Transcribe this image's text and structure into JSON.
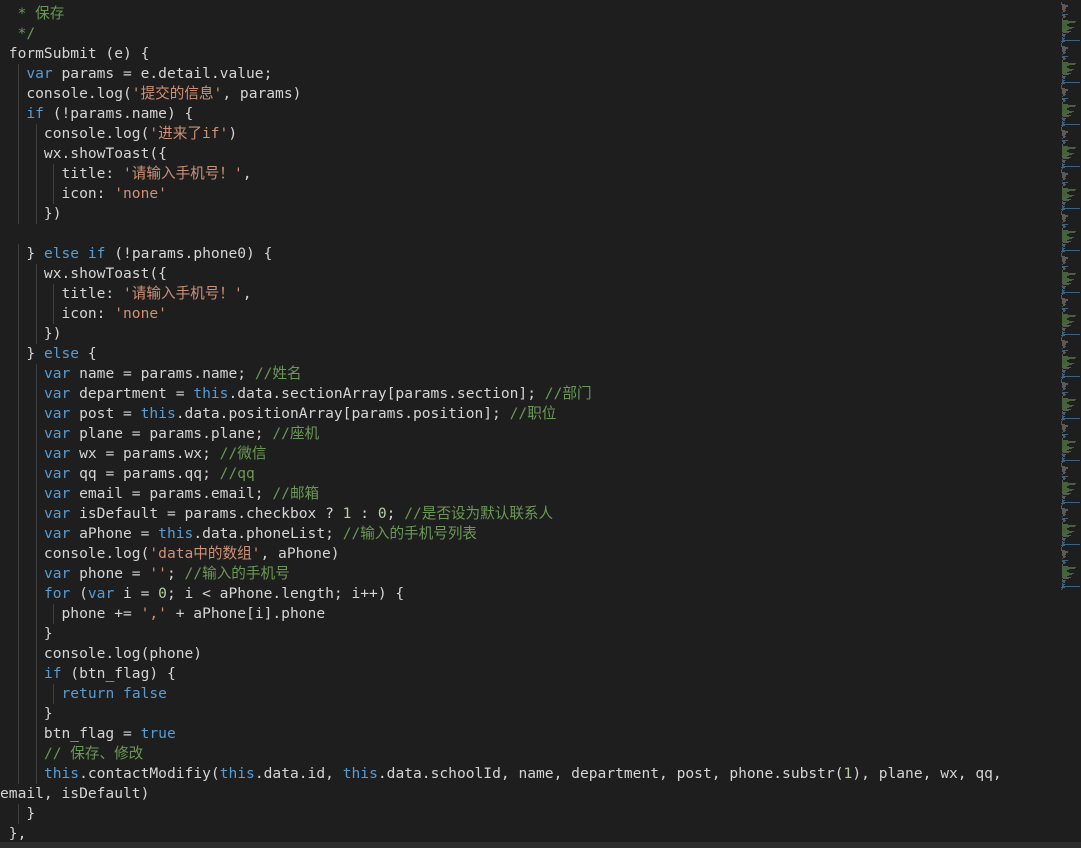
{
  "colors": {
    "background": "#1e1e1e",
    "keyword": "#569cd6",
    "string": "#ce9178",
    "comment": "#6a9955",
    "number": "#b5cea8",
    "text": "#d4d4d4"
  },
  "code_lines": [
    [
      {
        "t": "  * 保存",
        "c": "cm"
      }
    ],
    [
      {
        "t": "  */",
        "c": "cm"
      }
    ],
    [
      {
        "t": " formSubmit (e) {",
        "c": ""
      }
    ],
    [
      {
        "t": "   ",
        "c": ""
      },
      {
        "t": "var",
        "c": "kw"
      },
      {
        "t": " params = e.detail.value;",
        "c": ""
      }
    ],
    [
      {
        "t": "   console.log(",
        "c": ""
      },
      {
        "t": "'提交的信息'",
        "c": "str"
      },
      {
        "t": ", params)",
        "c": ""
      }
    ],
    [
      {
        "t": "   ",
        "c": ""
      },
      {
        "t": "if",
        "c": "kw"
      },
      {
        "t": " (!params.name) {",
        "c": ""
      }
    ],
    [
      {
        "t": "     console.log(",
        "c": ""
      },
      {
        "t": "'进来了if'",
        "c": "str"
      },
      {
        "t": ")",
        "c": ""
      }
    ],
    [
      {
        "t": "     wx.showToast({",
        "c": ""
      }
    ],
    [
      {
        "t": "       title: ",
        "c": ""
      },
      {
        "t": "'请输入手机号！'",
        "c": "str"
      },
      {
        "t": ",",
        "c": ""
      }
    ],
    [
      {
        "t": "       icon: ",
        "c": ""
      },
      {
        "t": "'none'",
        "c": "str"
      }
    ],
    [
      {
        "t": "     })",
        "c": ""
      }
    ],
    [
      {
        "t": "",
        "c": ""
      }
    ],
    [
      {
        "t": "   } ",
        "c": ""
      },
      {
        "t": "else",
        "c": "kw"
      },
      {
        "t": " ",
        "c": ""
      },
      {
        "t": "if",
        "c": "kw"
      },
      {
        "t": " (!params.phone0) {",
        "c": ""
      }
    ],
    [
      {
        "t": "     wx.showToast({",
        "c": ""
      }
    ],
    [
      {
        "t": "       title: ",
        "c": ""
      },
      {
        "t": "'请输入手机号！'",
        "c": "str"
      },
      {
        "t": ",",
        "c": ""
      }
    ],
    [
      {
        "t": "       icon: ",
        "c": ""
      },
      {
        "t": "'none'",
        "c": "str"
      }
    ],
    [
      {
        "t": "     })",
        "c": ""
      }
    ],
    [
      {
        "t": "   } ",
        "c": ""
      },
      {
        "t": "else",
        "c": "kw"
      },
      {
        "t": " {",
        "c": ""
      }
    ],
    [
      {
        "t": "     ",
        "c": ""
      },
      {
        "t": "var",
        "c": "kw"
      },
      {
        "t": " name = params.name; ",
        "c": ""
      },
      {
        "t": "//姓名",
        "c": "cm"
      }
    ],
    [
      {
        "t": "     ",
        "c": ""
      },
      {
        "t": "var",
        "c": "kw"
      },
      {
        "t": " department = ",
        "c": ""
      },
      {
        "t": "this",
        "c": "kw"
      },
      {
        "t": ".data.sectionArray[params.section]; ",
        "c": ""
      },
      {
        "t": "//部门",
        "c": "cm"
      }
    ],
    [
      {
        "t": "     ",
        "c": ""
      },
      {
        "t": "var",
        "c": "kw"
      },
      {
        "t": " post = ",
        "c": ""
      },
      {
        "t": "this",
        "c": "kw"
      },
      {
        "t": ".data.positionArray[params.position]; ",
        "c": ""
      },
      {
        "t": "//职位",
        "c": "cm"
      }
    ],
    [
      {
        "t": "     ",
        "c": ""
      },
      {
        "t": "var",
        "c": "kw"
      },
      {
        "t": " plane = params.plane; ",
        "c": ""
      },
      {
        "t": "//座机",
        "c": "cm"
      }
    ],
    [
      {
        "t": "     ",
        "c": ""
      },
      {
        "t": "var",
        "c": "kw"
      },
      {
        "t": " wx = params.wx; ",
        "c": ""
      },
      {
        "t": "//微信",
        "c": "cm"
      }
    ],
    [
      {
        "t": "     ",
        "c": ""
      },
      {
        "t": "var",
        "c": "kw"
      },
      {
        "t": " qq = params.qq; ",
        "c": ""
      },
      {
        "t": "//qq",
        "c": "cm"
      }
    ],
    [
      {
        "t": "     ",
        "c": ""
      },
      {
        "t": "var",
        "c": "kw"
      },
      {
        "t": " email = params.email; ",
        "c": ""
      },
      {
        "t": "//邮箱",
        "c": "cm"
      }
    ],
    [
      {
        "t": "     ",
        "c": ""
      },
      {
        "t": "var",
        "c": "kw"
      },
      {
        "t": " isDefault = params.checkbox ? ",
        "c": ""
      },
      {
        "t": "1",
        "c": "num"
      },
      {
        "t": " : ",
        "c": ""
      },
      {
        "t": "0",
        "c": "num"
      },
      {
        "t": "; ",
        "c": ""
      },
      {
        "t": "//是否设为默认联系人",
        "c": "cm"
      }
    ],
    [
      {
        "t": "     ",
        "c": ""
      },
      {
        "t": "var",
        "c": "kw"
      },
      {
        "t": " aPhone = ",
        "c": ""
      },
      {
        "t": "this",
        "c": "kw"
      },
      {
        "t": ".data.phoneList; ",
        "c": ""
      },
      {
        "t": "//输入的手机号列表",
        "c": "cm"
      }
    ],
    [
      {
        "t": "     console.log(",
        "c": ""
      },
      {
        "t": "'data中的数组'",
        "c": "str"
      },
      {
        "t": ", aPhone)",
        "c": ""
      }
    ],
    [
      {
        "t": "     ",
        "c": ""
      },
      {
        "t": "var",
        "c": "kw"
      },
      {
        "t": " phone = ",
        "c": ""
      },
      {
        "t": "''",
        "c": "str"
      },
      {
        "t": "; ",
        "c": ""
      },
      {
        "t": "//输入的手机号",
        "c": "cm"
      }
    ],
    [
      {
        "t": "     ",
        "c": ""
      },
      {
        "t": "for",
        "c": "kw"
      },
      {
        "t": " (",
        "c": ""
      },
      {
        "t": "var",
        "c": "kw"
      },
      {
        "t": " i = ",
        "c": ""
      },
      {
        "t": "0",
        "c": "num"
      },
      {
        "t": "; i < aPhone.length; i++) {",
        "c": ""
      }
    ],
    [
      {
        "t": "       phone += ",
        "c": ""
      },
      {
        "t": "','",
        "c": "str"
      },
      {
        "t": " + aPhone[i].phone",
        "c": ""
      }
    ],
    [
      {
        "t": "     }",
        "c": ""
      }
    ],
    [
      {
        "t": "     console.log(phone)",
        "c": ""
      }
    ],
    [
      {
        "t": "     ",
        "c": ""
      },
      {
        "t": "if",
        "c": "kw"
      },
      {
        "t": " (btn_flag) {",
        "c": ""
      }
    ],
    [
      {
        "t": "       ",
        "c": ""
      },
      {
        "t": "return",
        "c": "kw"
      },
      {
        "t": " ",
        "c": ""
      },
      {
        "t": "false",
        "c": "kw"
      }
    ],
    [
      {
        "t": "     }",
        "c": ""
      }
    ],
    [
      {
        "t": "     btn_flag = ",
        "c": ""
      },
      {
        "t": "true",
        "c": "kw"
      }
    ],
    [
      {
        "t": "     ",
        "c": ""
      },
      {
        "t": "// 保存、修改",
        "c": "cm"
      }
    ],
    [
      {
        "t": "     ",
        "c": ""
      },
      {
        "t": "this",
        "c": "kw"
      },
      {
        "t": ".contactModifiy(",
        "c": ""
      },
      {
        "t": "this",
        "c": "kw"
      },
      {
        "t": ".data.id, ",
        "c": ""
      },
      {
        "t": "this",
        "c": "kw"
      },
      {
        "t": ".data.schoolId, name, department, post, phone.substr(",
        "c": ""
      },
      {
        "t": "1",
        "c": "num"
      },
      {
        "t": "), plane, wx, qq,",
        "c": ""
      }
    ],
    [
      {
        "t": "email, isDefault)",
        "c": ""
      }
    ],
    [
      {
        "t": "   }",
        "c": ""
      }
    ],
    [
      {
        "t": " },",
        "c": ""
      }
    ]
  ]
}
